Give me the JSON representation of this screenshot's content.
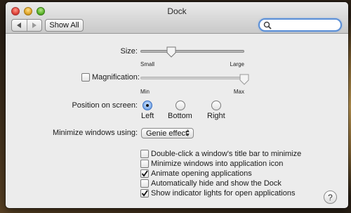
{
  "window": {
    "title": "Dock"
  },
  "toolbar": {
    "back_icon": "back-arrow-icon",
    "forward_icon": "forward-arrow-icon",
    "show_all_label": "Show All",
    "search": {
      "value": "",
      "placeholder": ""
    }
  },
  "size": {
    "label": "Size:",
    "min_label": "Small",
    "max_label": "Large",
    "value_fraction": 0.3
  },
  "magnification": {
    "label": "Magnification:",
    "checked": false,
    "min_label": "Min",
    "max_label": "Max",
    "value_fraction": 1.0
  },
  "position": {
    "label": "Position on screen:",
    "options": [
      "Left",
      "Bottom",
      "Right"
    ],
    "selected": "Left"
  },
  "minimize": {
    "label": "Minimize windows using:",
    "selected_value": "Genie effect"
  },
  "checkboxes": [
    {
      "label": "Double-click a window's title bar to minimize",
      "checked": false
    },
    {
      "label": "Minimize windows into application icon",
      "checked": false
    },
    {
      "label": "Animate opening applications",
      "checked": true
    },
    {
      "label": "Automatically hide and show the Dock",
      "checked": false
    },
    {
      "label": "Show indicator lights for open applications",
      "checked": true
    }
  ],
  "help": {
    "label": "?"
  },
  "colors": {
    "accent": "#3e7bd0",
    "window_bg": "#ececec"
  }
}
